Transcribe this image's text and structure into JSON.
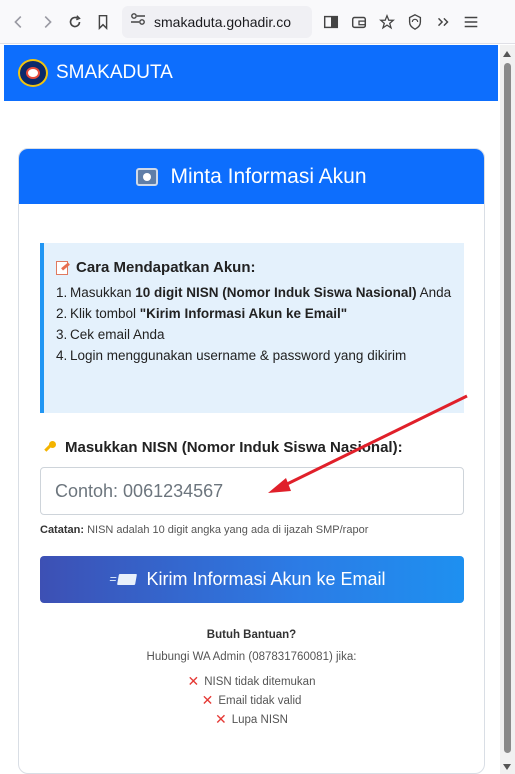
{
  "browser": {
    "url": "smakaduta.gohadir.co"
  },
  "navbar": {
    "brand": "SMAKADUTA"
  },
  "card": {
    "title": "Minta Informasi Akun"
  },
  "info": {
    "title": "Cara Mendapatkan Akun:",
    "steps": [
      {
        "num": "1.",
        "pre": "Masukkan ",
        "bold": "10 digit NISN (Nomor Induk Siswa Nasional)",
        "post": " Anda"
      },
      {
        "num": "2.",
        "pre": "Klik tombol ",
        "bold": "\"Kirim Informasi Akun ke Email\"",
        "post": ""
      },
      {
        "num": "3.",
        "pre": "Cek email Anda",
        "bold": "",
        "post": ""
      },
      {
        "num": "4.",
        "pre": "Login menggunakan username & password yang dikirim",
        "bold": "",
        "post": ""
      }
    ]
  },
  "form": {
    "label": "Masukkan NISN (Nomor Induk Siswa Nasional):",
    "placeholder": "Contoh: 0061234567",
    "note_label": "Catatan:",
    "note_text": " NISN adalah 10 digit angka yang ada di ijazah SMP/rapor",
    "submit_label": "Kirim Informasi Akun ke Email"
  },
  "help": {
    "title": "Butuh Bantuan?",
    "subtitle": "Hubungi WA Admin (087831760081) jika:",
    "items": [
      "NISN tidak ditemukan",
      "Email tidak valid",
      "Lupa NISN"
    ]
  },
  "colors": {
    "primary": "#0d6efd",
    "info_bg": "#e4f1fc",
    "info_border": "#2196f3",
    "error_x": "#e53935",
    "annotation_arrow": "#e0202a"
  }
}
